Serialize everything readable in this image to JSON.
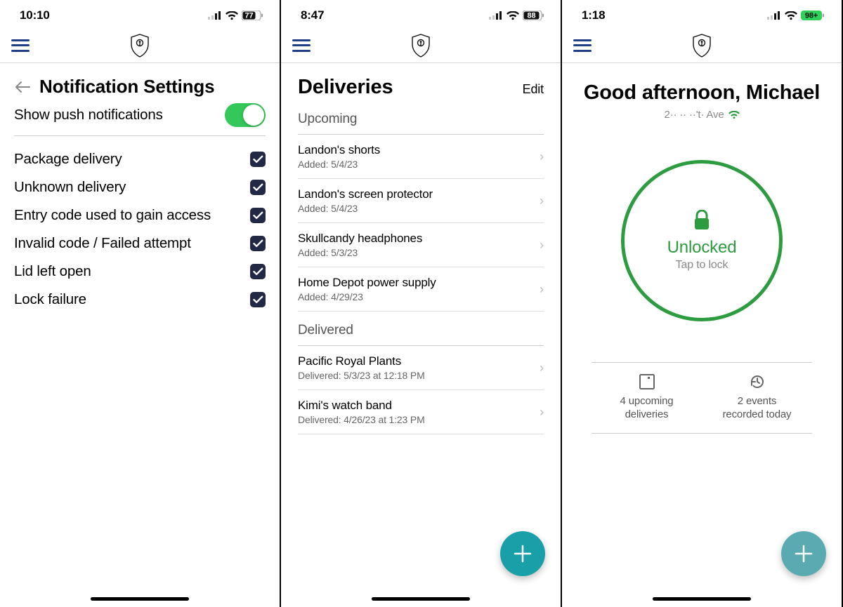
{
  "screens": {
    "settings": {
      "status": {
        "time": "10:10",
        "battery": "77"
      },
      "title": "Notification Settings",
      "push_label": "Show push notifications",
      "push_on": true,
      "items": [
        {
          "label": "Package delivery",
          "checked": true
        },
        {
          "label": "Unknown delivery",
          "checked": true
        },
        {
          "label": "Entry code used to gain access",
          "checked": true
        },
        {
          "label": "Invalid code / Failed attempt",
          "checked": true
        },
        {
          "label": "Lid left open",
          "checked": true
        },
        {
          "label": "Lock failure",
          "checked": true
        }
      ]
    },
    "deliveries": {
      "status": {
        "time": "8:47",
        "battery": "88"
      },
      "title": "Deliveries",
      "edit_label": "Edit",
      "upcoming_header": "Upcoming",
      "delivered_header": "Delivered",
      "upcoming": [
        {
          "name": "Landon's shorts",
          "meta": "Added: 5/4/23"
        },
        {
          "name": "Landon's screen protector",
          "meta": "Added: 5/4/23"
        },
        {
          "name": "Skullcandy headphones",
          "meta": "Added: 5/3/23"
        },
        {
          "name": "Home Depot power supply",
          "meta": "Added: 4/29/23"
        }
      ],
      "delivered": [
        {
          "name": "Pacific Royal Plants",
          "meta": "Delivered: 5/3/23 at 12:18 PM"
        },
        {
          "name": "Kimi's watch band",
          "meta": "Delivered: 4/26/23 at 1:23 PM"
        }
      ]
    },
    "home": {
      "status": {
        "time": "1:18",
        "battery": "98+"
      },
      "greeting": "Good afternoon, Michael",
      "address_obscured": "2·· ·· ··'t· Ave",
      "lock": {
        "status": "Unlocked",
        "hint": "Tap to lock"
      },
      "stats": {
        "deliveries_line1": "4 upcoming",
        "deliveries_line2": "deliveries",
        "events_line1": "2 events",
        "events_line2": "recorded today"
      }
    }
  }
}
